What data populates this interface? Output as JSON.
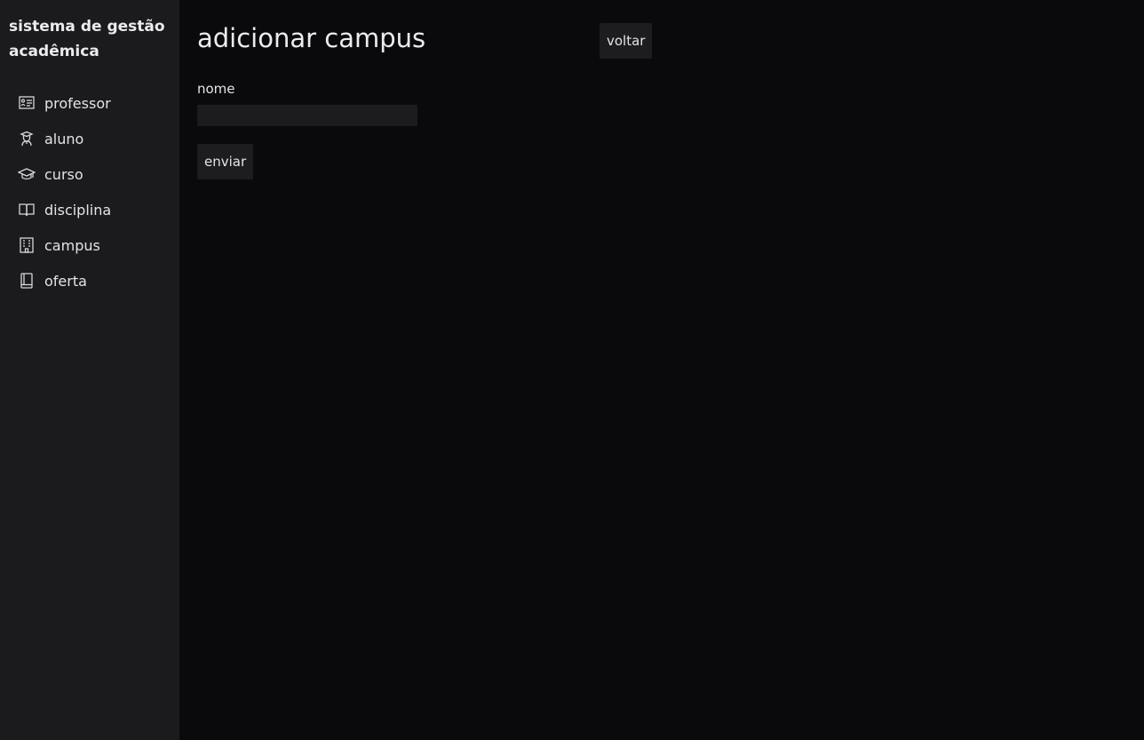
{
  "app": {
    "title": "sistema de gestão acadêmica"
  },
  "sidebar": {
    "items": [
      {
        "label": "professor",
        "icon": "presentation-board-icon"
      },
      {
        "label": "aluno",
        "icon": "student-icon"
      },
      {
        "label": "curso",
        "icon": "graduation-cap-icon"
      },
      {
        "label": "disciplina",
        "icon": "open-book-icon"
      },
      {
        "label": "campus",
        "icon": "building-icon"
      },
      {
        "label": "oferta",
        "icon": "closed-book-icon"
      }
    ]
  },
  "main": {
    "title": "adicionar campus",
    "back_label": "voltar",
    "form": {
      "nome_label": "nome",
      "nome_value": "",
      "nome_placeholder": "",
      "submit_label": "enviar"
    }
  },
  "colors": {
    "background": "#0a0a0c",
    "sidebar": "#1b1b1d",
    "button": "#1d1d20",
    "input": "#1c1c1f",
    "text": "#e4e4e6"
  }
}
